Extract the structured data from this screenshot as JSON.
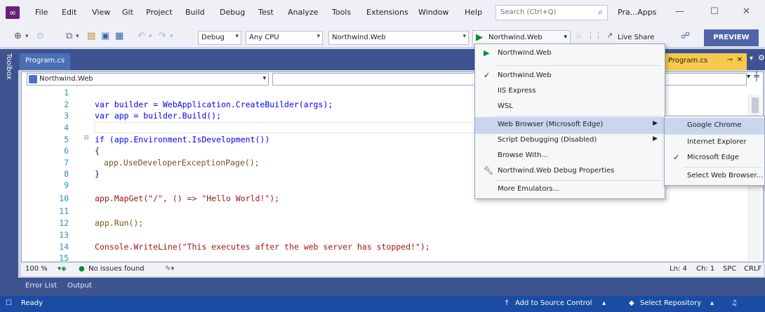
{
  "menubar": {
    "items": [
      "File",
      "Edit",
      "View",
      "Git",
      "Project",
      "Build",
      "Debug",
      "Test",
      "Analyze",
      "Tools",
      "Extensions",
      "Window",
      "Help"
    ],
    "search_placeholder": "Search (Ctrl+Q)",
    "solution_name": "Pra...Apps"
  },
  "toolbar": {
    "config": "Debug",
    "platform": "Any CPU",
    "startup_project": "Northwind.Web",
    "run_target": "Northwind.Web",
    "live_share": "Live Share",
    "preview": "PREVIEW"
  },
  "toolbox_label": "Toolbox",
  "doc_tab": {
    "title": "Program.cs",
    "right_tab": "Program.cs"
  },
  "nav_combo": "Northwind.Web",
  "code_lines": [
    {
      "n": "1",
      "text": ""
    },
    {
      "n": "2",
      "text": "var builder = WebApplication.CreateBuilder(args);"
    },
    {
      "n": "3",
      "text": "var app = builder.Build();"
    },
    {
      "n": "4",
      "text": ""
    },
    {
      "n": "5",
      "text": "if (app.Environment.IsDevelopment())"
    },
    {
      "n": "6",
      "text": "{"
    },
    {
      "n": "7",
      "text": "app.UseDeveloperExceptionPage();"
    },
    {
      "n": "8",
      "text": "}"
    },
    {
      "n": "9",
      "text": ""
    },
    {
      "n": "10",
      "text": "app.MapGet(\"/\", () => \"Hello World!\");"
    },
    {
      "n": "11",
      "text": ""
    },
    {
      "n": "12",
      "text": "app.Run();"
    },
    {
      "n": "13",
      "text": ""
    },
    {
      "n": "14",
      "text": "Console.WriteLine(\"This executes after the web server has stopped!\");"
    },
    {
      "n": "15",
      "text": ""
    }
  ],
  "editor_status": {
    "zoom": "100 %",
    "issues": "No issues found",
    "ln": "Ln: 4",
    "ch": "Ch: 1",
    "spc": "SPC",
    "crlf": "CRLF"
  },
  "bottom_tabs": [
    "Error List",
    "Output"
  ],
  "statusbar": {
    "ready": "Ready",
    "source_control": "Add to Source Control",
    "repository": "Select Repository"
  },
  "run_menu": {
    "items": [
      {
        "label": "Northwind.Web",
        "mark": "play"
      },
      {
        "label": "Northwind.Web",
        "mark": "check"
      },
      {
        "label": "IIS Express",
        "mark": ""
      },
      {
        "label": "WSL",
        "mark": ""
      },
      {
        "label": "Web Browser (Microsoft Edge)",
        "mark": "",
        "submenu": true
      },
      {
        "label": "Script Debugging (Disabled)",
        "mark": "",
        "submenu": true
      },
      {
        "label": "Browse With...",
        "mark": ""
      },
      {
        "label": "Northwind.Web Debug Properties",
        "mark": "wrench"
      },
      {
        "label": "More Emulators...",
        "mark": ""
      }
    ]
  },
  "browser_menu": {
    "items": [
      {
        "label": "Google Chrome",
        "checked": false
      },
      {
        "label": "Internet Explorer",
        "checked": false
      },
      {
        "label": "Microsoft Edge",
        "checked": true
      },
      {
        "label": "Select Web Browser...",
        "checked": false
      }
    ]
  },
  "colors": {
    "accent": "#3e5490",
    "statusbar": "#1b4ca3",
    "preview": "#4f65a9"
  }
}
